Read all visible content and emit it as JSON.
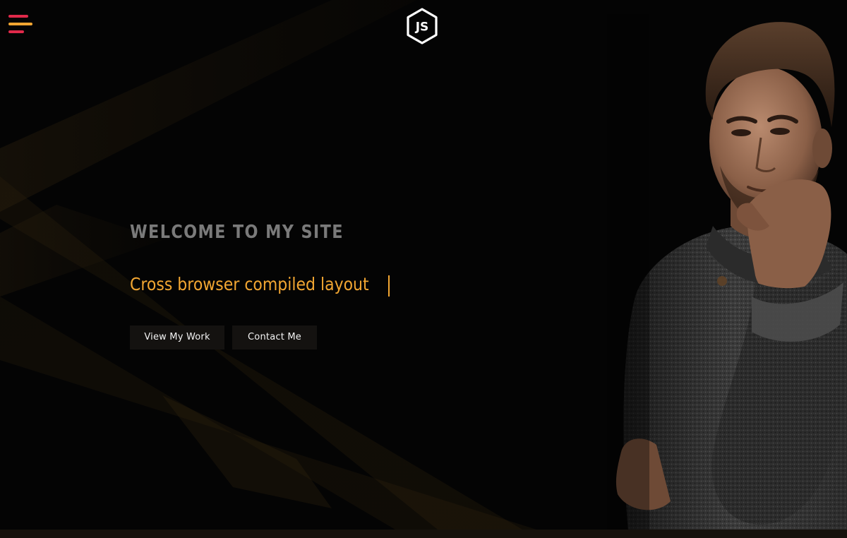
{
  "header": {
    "menu_icon": "hamburger-menu-icon",
    "logo_icon": "js-hexagon-logo-icon",
    "logo_text": "JS"
  },
  "hero": {
    "welcome": "WELCOME TO MY SITE",
    "tagline": "Cross browser compiled layout",
    "buttons": {
      "view_work": "View My Work",
      "contact": "Contact Me"
    },
    "portrait": "man-portrait-image"
  },
  "colors": {
    "background": "#040404",
    "accent_orange": "#f2a632",
    "menu_red": "#e0294a",
    "menu_yellow": "#f2a632",
    "welcome_gray": "#7a7a7a",
    "button_bg": "#141210"
  }
}
